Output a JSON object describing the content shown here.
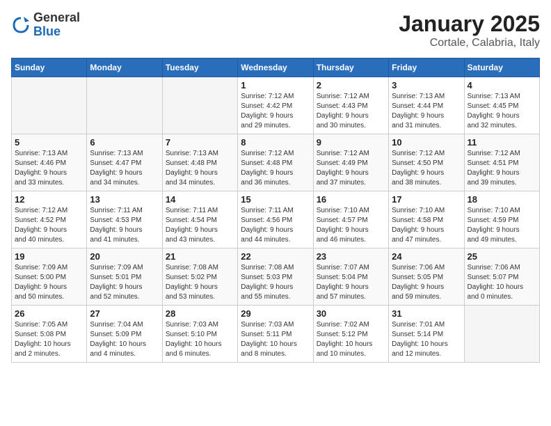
{
  "header": {
    "logo_line1": "General",
    "logo_line2": "Blue",
    "month_title": "January 2025",
    "subtitle": "Cortale, Calabria, Italy"
  },
  "days_of_week": [
    "Sunday",
    "Monday",
    "Tuesday",
    "Wednesday",
    "Thursday",
    "Friday",
    "Saturday"
  ],
  "weeks": [
    [
      {
        "day": "",
        "info": ""
      },
      {
        "day": "",
        "info": ""
      },
      {
        "day": "",
        "info": ""
      },
      {
        "day": "1",
        "info": "Sunrise: 7:12 AM\nSunset: 4:42 PM\nDaylight: 9 hours\nand 29 minutes."
      },
      {
        "day": "2",
        "info": "Sunrise: 7:12 AM\nSunset: 4:43 PM\nDaylight: 9 hours\nand 30 minutes."
      },
      {
        "day": "3",
        "info": "Sunrise: 7:13 AM\nSunset: 4:44 PM\nDaylight: 9 hours\nand 31 minutes."
      },
      {
        "day": "4",
        "info": "Sunrise: 7:13 AM\nSunset: 4:45 PM\nDaylight: 9 hours\nand 32 minutes."
      }
    ],
    [
      {
        "day": "5",
        "info": "Sunrise: 7:13 AM\nSunset: 4:46 PM\nDaylight: 9 hours\nand 33 minutes."
      },
      {
        "day": "6",
        "info": "Sunrise: 7:13 AM\nSunset: 4:47 PM\nDaylight: 9 hours\nand 34 minutes."
      },
      {
        "day": "7",
        "info": "Sunrise: 7:13 AM\nSunset: 4:48 PM\nDaylight: 9 hours\nand 34 minutes."
      },
      {
        "day": "8",
        "info": "Sunrise: 7:12 AM\nSunset: 4:48 PM\nDaylight: 9 hours\nand 36 minutes."
      },
      {
        "day": "9",
        "info": "Sunrise: 7:12 AM\nSunset: 4:49 PM\nDaylight: 9 hours\nand 37 minutes."
      },
      {
        "day": "10",
        "info": "Sunrise: 7:12 AM\nSunset: 4:50 PM\nDaylight: 9 hours\nand 38 minutes."
      },
      {
        "day": "11",
        "info": "Sunrise: 7:12 AM\nSunset: 4:51 PM\nDaylight: 9 hours\nand 39 minutes."
      }
    ],
    [
      {
        "day": "12",
        "info": "Sunrise: 7:12 AM\nSunset: 4:52 PM\nDaylight: 9 hours\nand 40 minutes."
      },
      {
        "day": "13",
        "info": "Sunrise: 7:11 AM\nSunset: 4:53 PM\nDaylight: 9 hours\nand 41 minutes."
      },
      {
        "day": "14",
        "info": "Sunrise: 7:11 AM\nSunset: 4:54 PM\nDaylight: 9 hours\nand 43 minutes."
      },
      {
        "day": "15",
        "info": "Sunrise: 7:11 AM\nSunset: 4:56 PM\nDaylight: 9 hours\nand 44 minutes."
      },
      {
        "day": "16",
        "info": "Sunrise: 7:10 AM\nSunset: 4:57 PM\nDaylight: 9 hours\nand 46 minutes."
      },
      {
        "day": "17",
        "info": "Sunrise: 7:10 AM\nSunset: 4:58 PM\nDaylight: 9 hours\nand 47 minutes."
      },
      {
        "day": "18",
        "info": "Sunrise: 7:10 AM\nSunset: 4:59 PM\nDaylight: 9 hours\nand 49 minutes."
      }
    ],
    [
      {
        "day": "19",
        "info": "Sunrise: 7:09 AM\nSunset: 5:00 PM\nDaylight: 9 hours\nand 50 minutes."
      },
      {
        "day": "20",
        "info": "Sunrise: 7:09 AM\nSunset: 5:01 PM\nDaylight: 9 hours\nand 52 minutes."
      },
      {
        "day": "21",
        "info": "Sunrise: 7:08 AM\nSunset: 5:02 PM\nDaylight: 9 hours\nand 53 minutes."
      },
      {
        "day": "22",
        "info": "Sunrise: 7:08 AM\nSunset: 5:03 PM\nDaylight: 9 hours\nand 55 minutes."
      },
      {
        "day": "23",
        "info": "Sunrise: 7:07 AM\nSunset: 5:04 PM\nDaylight: 9 hours\nand 57 minutes."
      },
      {
        "day": "24",
        "info": "Sunrise: 7:06 AM\nSunset: 5:05 PM\nDaylight: 9 hours\nand 59 minutes."
      },
      {
        "day": "25",
        "info": "Sunrise: 7:06 AM\nSunset: 5:07 PM\nDaylight: 10 hours\nand 0 minutes."
      }
    ],
    [
      {
        "day": "26",
        "info": "Sunrise: 7:05 AM\nSunset: 5:08 PM\nDaylight: 10 hours\nand 2 minutes."
      },
      {
        "day": "27",
        "info": "Sunrise: 7:04 AM\nSunset: 5:09 PM\nDaylight: 10 hours\nand 4 minutes."
      },
      {
        "day": "28",
        "info": "Sunrise: 7:03 AM\nSunset: 5:10 PM\nDaylight: 10 hours\nand 6 minutes."
      },
      {
        "day": "29",
        "info": "Sunrise: 7:03 AM\nSunset: 5:11 PM\nDaylight: 10 hours\nand 8 minutes."
      },
      {
        "day": "30",
        "info": "Sunrise: 7:02 AM\nSunset: 5:12 PM\nDaylight: 10 hours\nand 10 minutes."
      },
      {
        "day": "31",
        "info": "Sunrise: 7:01 AM\nSunset: 5:14 PM\nDaylight: 10 hours\nand 12 minutes."
      },
      {
        "day": "",
        "info": ""
      }
    ]
  ]
}
